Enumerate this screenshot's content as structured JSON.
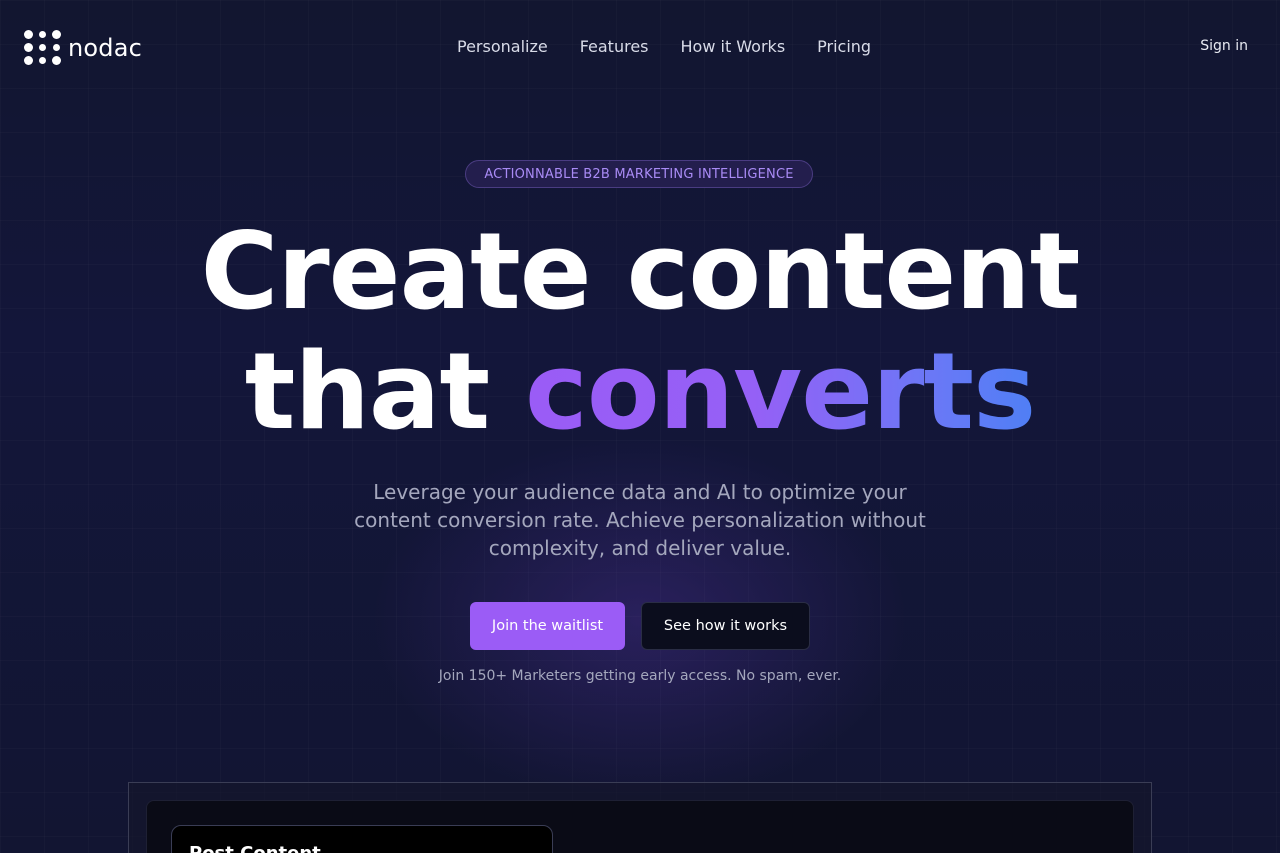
{
  "brand": {
    "name": "nodac",
    "logo_icon": "dot-grid-logo-icon"
  },
  "nav": {
    "items": [
      {
        "label": "Personalize"
      },
      {
        "label": "Features"
      },
      {
        "label": "How it Works"
      },
      {
        "label": "Pricing"
      }
    ],
    "signin_label": "Sign in"
  },
  "hero": {
    "badge": "ACTIONNABLE B2B MARKETING INTELLIGENCE",
    "title_line1": "Create content",
    "title_line2_plain": "that",
    "title_line2_highlight": "converts",
    "subtitle": "Leverage your audience data and AI to optimize your content conversion rate. Achieve personalization without complexity, and deliver value.",
    "primary_cta": "Join the waitlist",
    "secondary_cta": "See how it works",
    "note": "Join 150+ Marketers getting early access. No spam, ever."
  },
  "preview": {
    "card_title": "Post Content"
  },
  "colors": {
    "background": "#12152b",
    "accent_purple": "#9b5cf6",
    "accent_blue": "#4f7ff5",
    "badge_text": "#a98bf5"
  }
}
